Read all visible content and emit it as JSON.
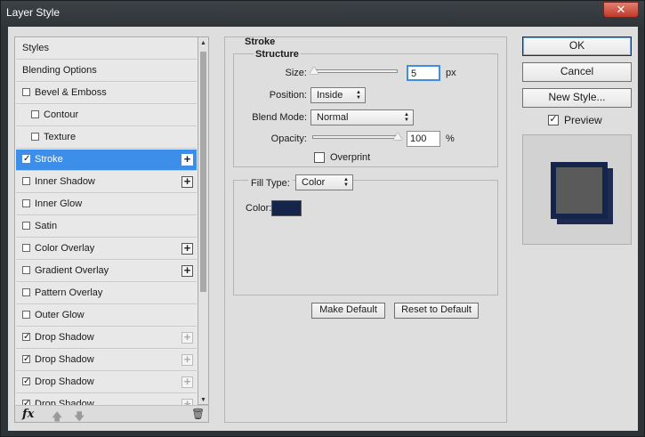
{
  "window": {
    "title": "Layer Style",
    "close_glyph": "✕"
  },
  "styles_list": {
    "items": [
      {
        "label": "Styles",
        "checkbox": false,
        "checked": false,
        "plus": "none",
        "indent": false,
        "selected": false
      },
      {
        "label": "Blending Options",
        "checkbox": false,
        "checked": false,
        "plus": "none",
        "indent": false,
        "selected": false
      },
      {
        "label": "Bevel & Emboss",
        "checkbox": true,
        "checked": false,
        "plus": "none",
        "indent": false,
        "selected": false
      },
      {
        "label": "Contour",
        "checkbox": true,
        "checked": false,
        "plus": "none",
        "indent": true,
        "selected": false
      },
      {
        "label": "Texture",
        "checkbox": true,
        "checked": false,
        "plus": "none",
        "indent": true,
        "selected": false
      },
      {
        "label": "Stroke",
        "checkbox": true,
        "checked": true,
        "plus": "active",
        "indent": false,
        "selected": true
      },
      {
        "label": "Inner Shadow",
        "checkbox": true,
        "checked": false,
        "plus": "active",
        "indent": false,
        "selected": false
      },
      {
        "label": "Inner Glow",
        "checkbox": true,
        "checked": false,
        "plus": "none",
        "indent": false,
        "selected": false
      },
      {
        "label": "Satin",
        "checkbox": true,
        "checked": false,
        "plus": "none",
        "indent": false,
        "selected": false
      },
      {
        "label": "Color Overlay",
        "checkbox": true,
        "checked": false,
        "plus": "active",
        "indent": false,
        "selected": false
      },
      {
        "label": "Gradient Overlay",
        "checkbox": true,
        "checked": false,
        "plus": "active",
        "indent": false,
        "selected": false
      },
      {
        "label": "Pattern Overlay",
        "checkbox": true,
        "checked": false,
        "plus": "none",
        "indent": false,
        "selected": false
      },
      {
        "label": "Outer Glow",
        "checkbox": true,
        "checked": false,
        "plus": "none",
        "indent": false,
        "selected": false
      },
      {
        "label": "Drop Shadow",
        "checkbox": true,
        "checked": true,
        "plus": "dim",
        "indent": false,
        "selected": false
      },
      {
        "label": "Drop Shadow",
        "checkbox": true,
        "checked": true,
        "plus": "dim",
        "indent": false,
        "selected": false
      },
      {
        "label": "Drop Shadow",
        "checkbox": true,
        "checked": true,
        "plus": "dim",
        "indent": false,
        "selected": false
      },
      {
        "label": "Drop Shadow",
        "checkbox": true,
        "checked": true,
        "plus": "dim",
        "indent": false,
        "selected": false
      }
    ],
    "footer": {
      "fx": "fx",
      "move_up_glyph": "🡅",
      "move_down_glyph": "🡇",
      "trash_glyph": "🗑"
    }
  },
  "stroke": {
    "title": "Stroke",
    "structure_title": "Structure",
    "size_label": "Size:",
    "size_value": "5",
    "size_unit": "px",
    "position_label": "Position:",
    "position_value": "Inside",
    "blend_mode_label": "Blend Mode:",
    "blend_mode_value": "Normal",
    "opacity_label": "Opacity:",
    "opacity_value": "100",
    "opacity_unit": "%",
    "overprint_label": "Overprint",
    "fill_type_label": "Fill Type:",
    "fill_type_value": "Color",
    "color_label": "Color:",
    "make_default": "Make Default",
    "reset_default": "Reset to Default",
    "size_slider_fraction": 0.02,
    "opacity_slider_fraction": 1.0
  },
  "colors": {
    "selected_row": "#3d8ee8",
    "stroke_color": "#15244a",
    "preview_fill": "#5a5a5a"
  },
  "actions": {
    "ok": "OK",
    "cancel": "Cancel",
    "new_style": "New Style...",
    "preview_label": "Preview",
    "preview_checked": true
  },
  "icons": {
    "check_glyph": "✓",
    "plus_glyph": "+",
    "dropdown_glyph": "▲▼",
    "scroll_up_glyph": "▲",
    "scroll_down_glyph": "▼"
  }
}
